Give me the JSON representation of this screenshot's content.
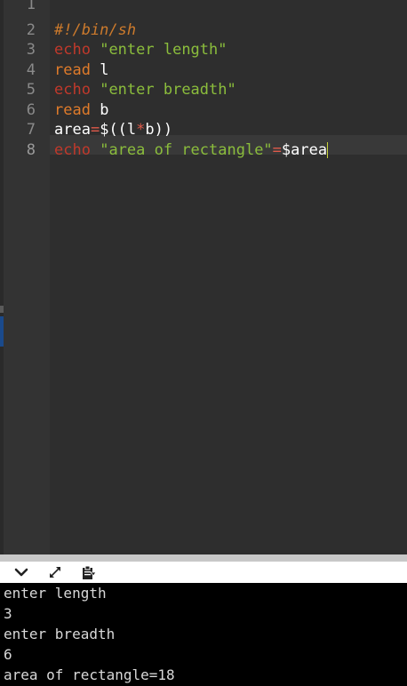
{
  "editor": {
    "lines": [
      {
        "num": "1",
        "tokens": []
      },
      {
        "num": "2",
        "tokens": [
          {
            "t": "#!/bin/sh",
            "c": "comment"
          }
        ]
      },
      {
        "num": "3",
        "tokens": [
          {
            "t": "echo",
            "c": "cmd"
          },
          {
            "t": " ",
            "c": "var"
          },
          {
            "t": "\"enter length\"",
            "c": "str"
          }
        ]
      },
      {
        "num": "4",
        "tokens": [
          {
            "t": "read",
            "c": "read"
          },
          {
            "t": " l",
            "c": "var"
          }
        ]
      },
      {
        "num": "5",
        "tokens": [
          {
            "t": "echo",
            "c": "cmd"
          },
          {
            "t": " ",
            "c": "var"
          },
          {
            "t": "\"enter breadth\"",
            "c": "str"
          }
        ]
      },
      {
        "num": "6",
        "tokens": [
          {
            "t": "read",
            "c": "read"
          },
          {
            "t": " b",
            "c": "var"
          }
        ]
      },
      {
        "num": "7",
        "tokens": [
          {
            "t": "area",
            "c": "var"
          },
          {
            "t": "=",
            "c": "op"
          },
          {
            "t": "$((l",
            "c": "var"
          },
          {
            "t": "*",
            "c": "op"
          },
          {
            "t": "b))",
            "c": "var"
          }
        ]
      },
      {
        "num": "8",
        "tokens": [
          {
            "t": "echo",
            "c": "cmd"
          },
          {
            "t": " ",
            "c": "var"
          },
          {
            "t": "\"area of rectangle\"",
            "c": "str"
          },
          {
            "t": "=",
            "c": "op"
          },
          {
            "t": "$area",
            "c": "var"
          }
        ]
      }
    ],
    "active_line": "8"
  },
  "toolbar": {
    "icons": [
      "chevron-down-icon",
      "expand-icon",
      "clipboard-icon"
    ]
  },
  "terminal": {
    "lines": [
      "enter length",
      "3",
      "enter breadth",
      "6",
      "area of rectangle=18"
    ]
  },
  "colors": {
    "comment": "#cc7a2c",
    "cmd": "#c0392b",
    "read": "#e07b2a",
    "str": "#8bbd3c",
    "var": "#ffffff",
    "op": "#e05a4a"
  }
}
